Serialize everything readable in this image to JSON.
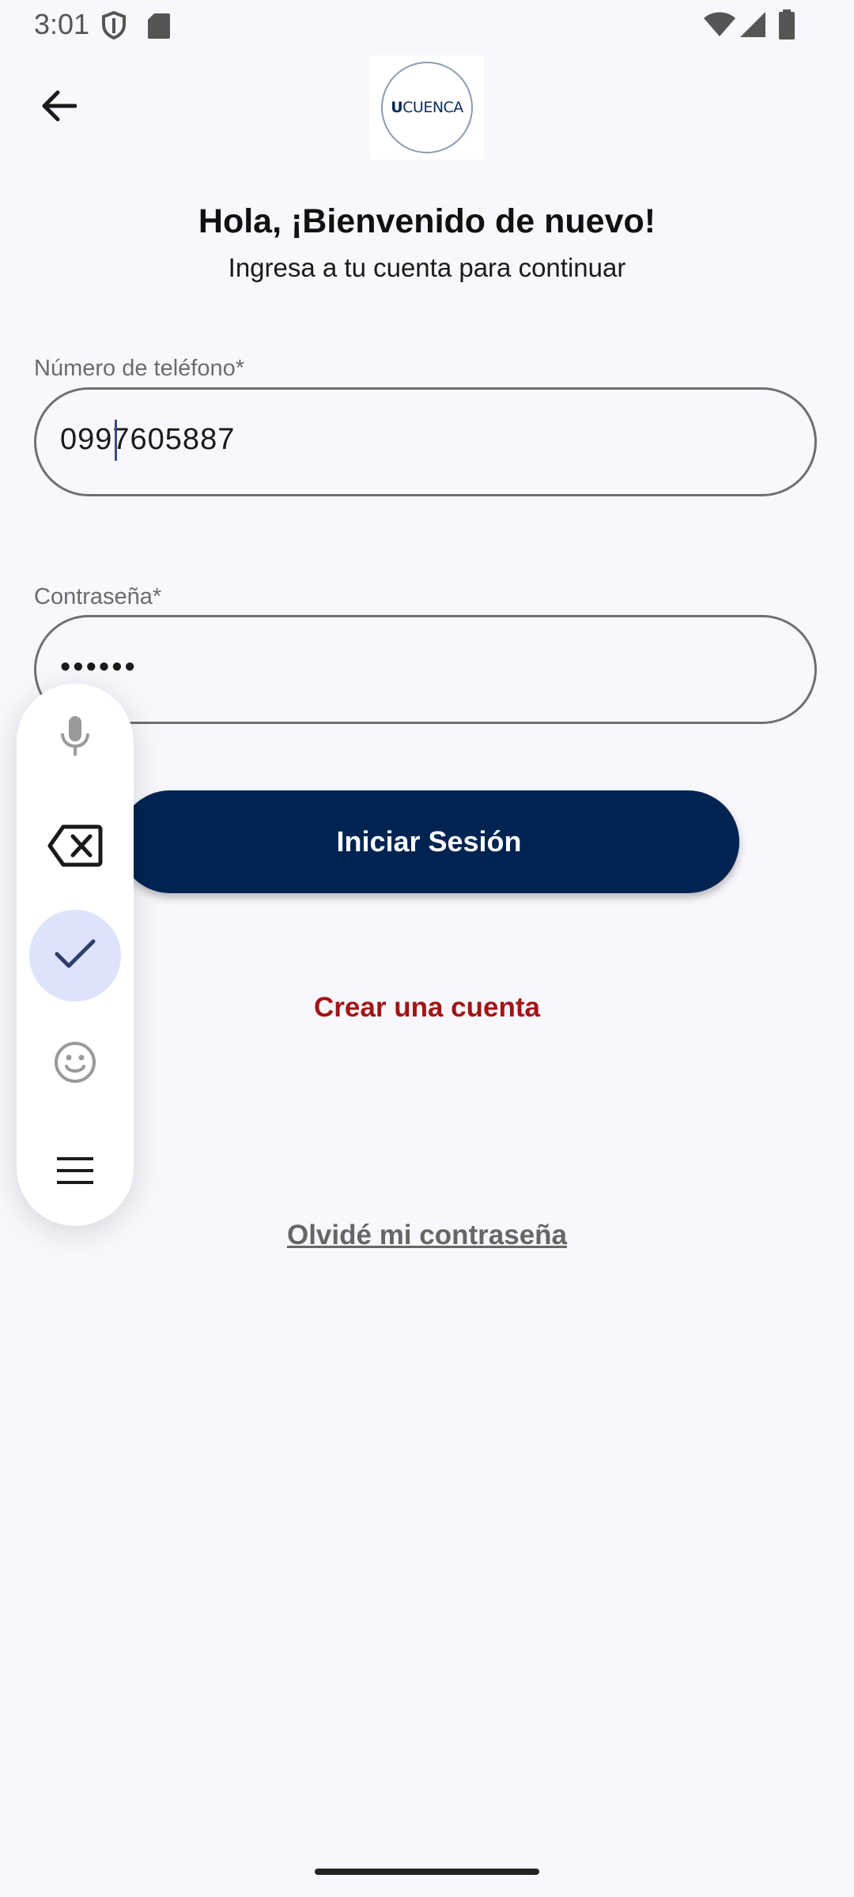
{
  "status_bar": {
    "time": "3:01",
    "icons": [
      "shield-icon",
      "sd-card-icon",
      "wifi-icon",
      "signal-icon",
      "battery-icon"
    ]
  },
  "top_bar": {
    "back_icon": "arrow-left-icon",
    "logo": {
      "mark": "U",
      "text": "CUENCA"
    }
  },
  "heading": {
    "title": "Hola, ¡Bienvenido de nuevo!",
    "subtitle": "Ingresa a tu cuenta para continuar"
  },
  "form": {
    "phone": {
      "label": "Número de teléfono*",
      "value": "0997605887"
    },
    "password": {
      "label": "Contraseña*",
      "value": "••••••"
    },
    "login_label": "Iniciar Sesión",
    "create_account_label": "Crear una cuenta",
    "forgot_password_label": "Olvidé mi contraseña"
  },
  "keyboard_toolbar": {
    "items": [
      "microphone-icon",
      "backspace-icon",
      "check-icon",
      "emoji-icon",
      "menu-icon"
    ],
    "active": "check-icon"
  },
  "colors": {
    "background": "#f8f7fd",
    "primary": "#002452",
    "create_account": "#a31414",
    "forgot_password": "#666666",
    "field_border": "#6f6f73",
    "toolbar_active": "#dde3fb"
  }
}
